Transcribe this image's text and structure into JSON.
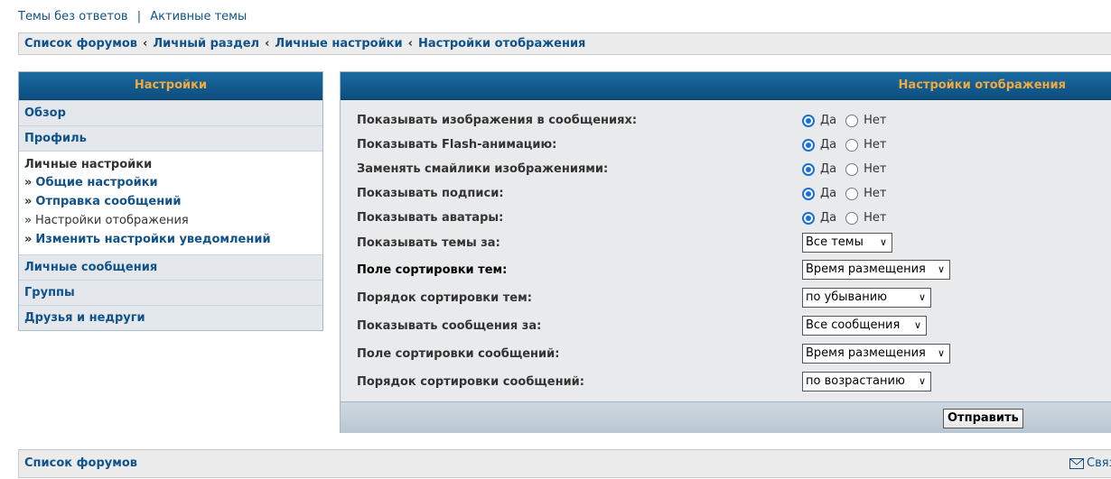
{
  "top_links": {
    "unanswered": "Темы без ответов",
    "separator": "|",
    "active": "Активные темы"
  },
  "breadcrumb": [
    "Список форумов",
    "Личный раздел",
    "Личные настройки",
    "Настройки отображения"
  ],
  "breadcrumb_sep": "‹",
  "left_panel": {
    "title": "Настройки",
    "items_top": [
      "Обзор",
      "Профиль"
    ],
    "active_group": {
      "title": "Личные настройки",
      "raquo": "»",
      "subitems": [
        "Общие настройки",
        "Отправка сообщений",
        "Настройки отображения",
        "Изменить настройки уведомлений"
      ]
    },
    "items_bottom": [
      "Личные сообщения",
      "Группы",
      "Друзья и недруги"
    ]
  },
  "right_panel": {
    "title": "Настройки отображения",
    "yes": "Да",
    "no": "Нет",
    "radio_rows": [
      {
        "label": "Показывать изображения в сообщениях:",
        "selected": "yes"
      },
      {
        "label": "Показывать Flash-анимацию:",
        "selected": "yes"
      },
      {
        "label": "Заменять смайлики изображениями:",
        "selected": "yes"
      },
      {
        "label": "Показывать подписи:",
        "selected": "yes"
      },
      {
        "label": "Показывать аватары:",
        "selected": "yes"
      }
    ],
    "select_rows": [
      {
        "label": "Показывать темы за:",
        "value": "Все темы"
      },
      {
        "label": "Поле сортировки тем:",
        "value": "Время размещения"
      },
      {
        "label": "Порядок сортировки тем:",
        "value": "по убыванию"
      },
      {
        "label": "Показывать сообщения за:",
        "value": "Все сообщения"
      },
      {
        "label": "Поле сортировки сообщений:",
        "value": "Время размещения"
      },
      {
        "label": "Порядок сортировки сообщений:",
        "value": "по возрастанию"
      }
    ],
    "submit": "Отправить"
  },
  "bottom": {
    "home": "Список форумов",
    "contact": "Связ"
  },
  "colors": {
    "header_text": "#f0a842",
    "link": "#105289",
    "header_bg": "#0c4e7e",
    "radio_on": "#1a6fd6"
  }
}
